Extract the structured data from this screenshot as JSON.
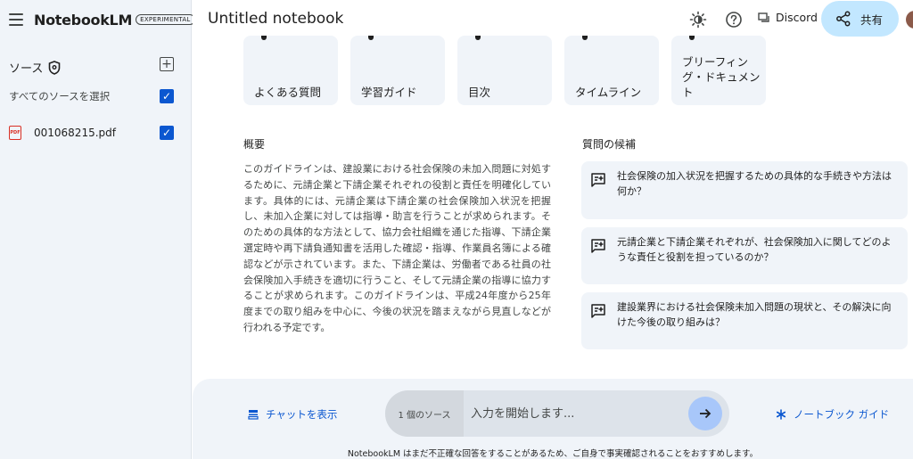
{
  "app": {
    "name": "NotebookLM",
    "badge": "EXPERIMENTAL"
  },
  "sidebar": {
    "sources_title": "ソース",
    "select_all_label": "すべてのソースを選択",
    "select_all_checked": true,
    "sources": [
      {
        "name": "001068215.pdf",
        "type": "PDF",
        "checked": true
      }
    ]
  },
  "header": {
    "notebook_title": "Untitled notebook",
    "discord_label": "Discord",
    "share_label": "共有"
  },
  "guide_cards": [
    {
      "label": "よくある質問"
    },
    {
      "label": "学習ガイド"
    },
    {
      "label": "目次"
    },
    {
      "label": "タイムライン"
    },
    {
      "label": "ブリーフィング・ドキュメント"
    }
  ],
  "summary": {
    "title": "概要",
    "text": "このガイドラインは、建設業における社会保険の未加入問題に対処するために、元請企業と下請企業それぞれの役割と責任を明確化しています。具体的には、元請企業は下請企業の社会保険加入状況を把握し、未加入企業に対しては指導・助言を行うことが求められます。そのための具体的な方法として、協力会社組織を通じた指導、下請企業選定時や再下請負通知書を活用した確認・指導、作業員名簿による確認などが示されています。また、下請企業は、労働者である社員の社会保険加入手続きを適切に行うこと、そして元請企業の指導に協力することが求められます。このガイドラインは、平成24年度から25年度までの取り組みを中心に、今後の状況を踏まえながら見直しなどが行われる予定です。"
  },
  "questions": {
    "title": "質問の候補",
    "items": [
      {
        "text": "社会保険の加入状況を把握するための具体的な手続きや方法は何か？"
      },
      {
        "text": "元請企業と下請企業それぞれが、社会保険加入に関してどのような責任と役割を担っているのか？"
      },
      {
        "text": "建設業界における社会保険未加入問題の現状と、その解決に向けた今後の取り組みは？"
      }
    ]
  },
  "chat": {
    "show_chat_label": "チャットを表示",
    "source_count": "1 個のソース",
    "input_placeholder": "入力を開始します...",
    "notebook_guide_label": "ノートブック ガイド",
    "disclaimer": "NotebookLM はまだ不正確な回答をすることがあるため、ご自身で事実確認されることをおすすめします。"
  },
  "icons": {
    "menu": "menu-icon",
    "shield": "shield-icon",
    "add": "add-icon",
    "pdf": "pdf-icon",
    "theme": "brightness-icon",
    "help": "help-icon",
    "discord": "discord-icon",
    "share": "share-icon",
    "question": "add-comment-icon",
    "chat": "chat-toggle-icon",
    "send": "arrow-right-icon",
    "guide": "asterisk-icon"
  },
  "colors": {
    "accent": "#0b57d0",
    "share_bg": "#c2e7ff",
    "surface": "#f0f4f9",
    "pdf": "#d93025"
  }
}
